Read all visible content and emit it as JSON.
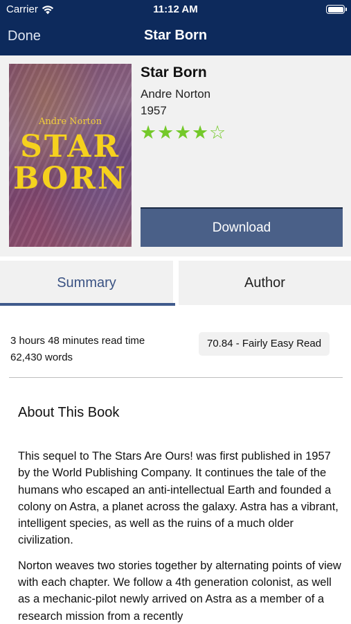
{
  "status_bar": {
    "carrier": "Carrier",
    "time": "11:12 AM"
  },
  "nav": {
    "done_label": "Done",
    "title": "Star Born"
  },
  "book": {
    "title": "Star Born",
    "author": "Andre Norton",
    "year": "1957",
    "rating": {
      "value": 4,
      "max": 5,
      "color": "#74c92a"
    },
    "cover": {
      "author": "Andre Norton",
      "title_line1": "STAR",
      "title_line2": "BORN"
    }
  },
  "actions": {
    "download_label": "Download"
  },
  "tabs": [
    {
      "label": "Summary",
      "selected": true
    },
    {
      "label": "Author",
      "selected": false
    }
  ],
  "stats": {
    "read_time": "3 hours 48 minutes read time",
    "words": "62,430 words",
    "readability": "70.84 - Fairly Easy Read"
  },
  "about": {
    "heading": "About This Book",
    "paragraphs": [
      "This sequel to The Stars Are Ours! was first published in 1957 by the World Publishing Company. It continues the tale of the humans who escaped an anti-intellectual Earth and founded a colony on Astra, a planet across the galaxy. Astra has a vibrant, intelligent species, as well as the ruins of a much older civilization.",
      "Norton weaves two stories together by alternating points of view with each chapter. We follow a 4th generation colonist, as well as a mechanic-pilot newly arrived on Astra as a member of a research mission from a recently"
    ]
  },
  "colors": {
    "nav_background": "#0d2a5c",
    "download_button": "#4a6088",
    "tab_accent": "#3f5a8c"
  }
}
